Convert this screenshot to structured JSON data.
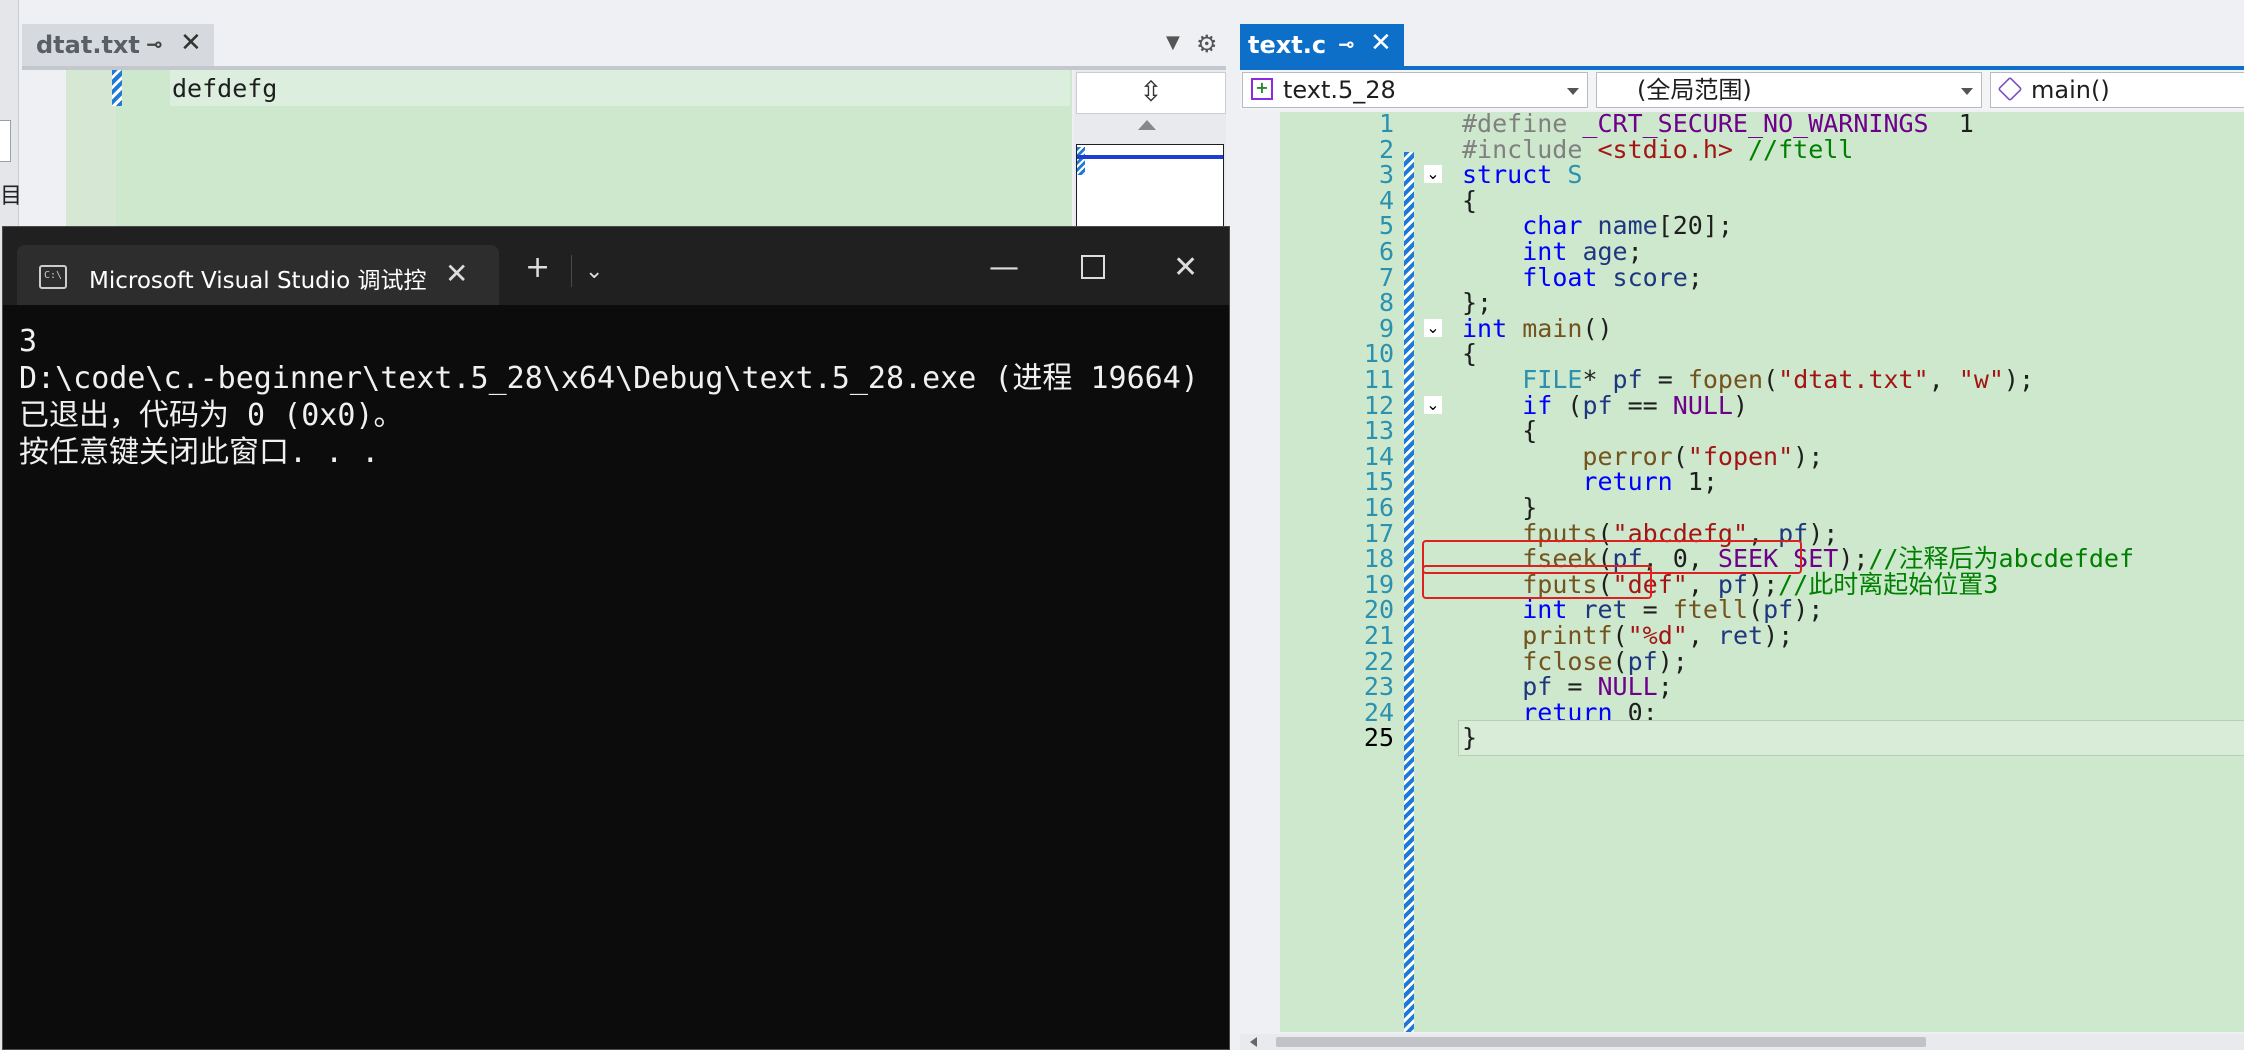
{
  "left_editor": {
    "tab_title": "dtat.txt",
    "content_line": "defdefg",
    "edge_char": "目"
  },
  "right_editor": {
    "tab_title": "text.c",
    "nav": {
      "project": "text.5_28",
      "scope": "(全局范围)",
      "function": "main()"
    },
    "current_line": 25,
    "lines": [
      {
        "n": 1,
        "tokens": [
          [
            "p",
            "#define "
          ],
          [
            "m",
            "_CRT_SECURE_NO_WARNINGS"
          ],
          [
            "",
            "  1"
          ]
        ]
      },
      {
        "n": 2,
        "tokens": [
          [
            "p",
            "#include "
          ],
          [
            "h",
            "<stdio.h>"
          ],
          [
            "c",
            " //ftell"
          ]
        ]
      },
      {
        "n": 3,
        "fold": true,
        "tokens": [
          [
            "k",
            "struct "
          ],
          [
            "t",
            "S"
          ]
        ]
      },
      {
        "n": 4,
        "tokens": [
          [
            "",
            "{"
          ]
        ]
      },
      {
        "n": 5,
        "tokens": [
          [
            "",
            "    "
          ],
          [
            "k",
            "char "
          ],
          [
            "v",
            "name"
          ],
          [
            "",
            "[20];"
          ]
        ]
      },
      {
        "n": 6,
        "tokens": [
          [
            "",
            "    "
          ],
          [
            "k",
            "int "
          ],
          [
            "v",
            "age"
          ],
          [
            "",
            ";"
          ]
        ]
      },
      {
        "n": 7,
        "tokens": [
          [
            "",
            "    "
          ],
          [
            "k",
            "float "
          ],
          [
            "v",
            "score"
          ],
          [
            "",
            ";"
          ]
        ]
      },
      {
        "n": 8,
        "tokens": [
          [
            "",
            "};"
          ]
        ]
      },
      {
        "n": 9,
        "fold": true,
        "tokens": [
          [
            "k",
            "int "
          ],
          [
            "f",
            "main"
          ],
          [
            "",
            "()"
          ]
        ]
      },
      {
        "n": 10,
        "tokens": [
          [
            "",
            "{"
          ]
        ]
      },
      {
        "n": 11,
        "tokens": [
          [
            "",
            "    "
          ],
          [
            "t",
            "FILE"
          ],
          [
            "",
            "* "
          ],
          [
            "v",
            "pf"
          ],
          [
            "",
            " = "
          ],
          [
            "f",
            "fopen"
          ],
          [
            "",
            "("
          ],
          [
            "s",
            "\"dtat.txt\""
          ],
          [
            "",
            ", "
          ],
          [
            "s",
            "\"w\""
          ],
          [
            "",
            ");"
          ]
        ]
      },
      {
        "n": 12,
        "fold": true,
        "tokens": [
          [
            "",
            "    "
          ],
          [
            "k",
            "if "
          ],
          [
            "",
            "("
          ],
          [
            "v",
            "pf"
          ],
          [
            "",
            " == "
          ],
          [
            "m",
            "NULL"
          ],
          [
            "",
            ")"
          ]
        ]
      },
      {
        "n": 13,
        "tokens": [
          [
            "",
            "    {"
          ]
        ]
      },
      {
        "n": 14,
        "tokens": [
          [
            "",
            "        "
          ],
          [
            "f",
            "perror"
          ],
          [
            "",
            "("
          ],
          [
            "s",
            "\"fopen\""
          ],
          [
            "",
            ");"
          ]
        ]
      },
      {
        "n": 15,
        "tokens": [
          [
            "",
            "        "
          ],
          [
            "k",
            "return "
          ],
          [
            "",
            "1;"
          ]
        ]
      },
      {
        "n": 16,
        "tokens": [
          [
            "",
            "    }"
          ]
        ]
      },
      {
        "n": 17,
        "tokens": [
          [
            "",
            "    "
          ],
          [
            "f",
            "fputs"
          ],
          [
            "",
            "("
          ],
          [
            "s",
            "\"abcdefg\""
          ],
          [
            "",
            ", "
          ],
          [
            "v",
            "pf"
          ],
          [
            "",
            ");"
          ]
        ]
      },
      {
        "n": 18,
        "tokens": [
          [
            "",
            "    "
          ],
          [
            "f",
            "fseek"
          ],
          [
            "",
            "("
          ],
          [
            "v",
            "pf"
          ],
          [
            "",
            ", 0, "
          ],
          [
            "m",
            "SEEK_SET"
          ],
          [
            "",
            ");"
          ],
          [
            "c",
            "//注释后为abcdefdef"
          ]
        ]
      },
      {
        "n": 19,
        "tokens": [
          [
            "",
            "    "
          ],
          [
            "f",
            "fputs"
          ],
          [
            "",
            "("
          ],
          [
            "s",
            "\"def\""
          ],
          [
            "",
            ", "
          ],
          [
            "v",
            "pf"
          ],
          [
            "",
            ");"
          ],
          [
            "c",
            "//此时离起始位置3"
          ]
        ]
      },
      {
        "n": 20,
        "tokens": [
          [
            "",
            "    "
          ],
          [
            "k",
            "int "
          ],
          [
            "v",
            "ret"
          ],
          [
            "",
            " = "
          ],
          [
            "f",
            "ftell"
          ],
          [
            "",
            "("
          ],
          [
            "v",
            "pf"
          ],
          [
            "",
            ");"
          ]
        ]
      },
      {
        "n": 21,
        "tokens": [
          [
            "",
            "    "
          ],
          [
            "f",
            "printf"
          ],
          [
            "",
            "("
          ],
          [
            "s",
            "\"%d\""
          ],
          [
            "",
            ", "
          ],
          [
            "v",
            "ret"
          ],
          [
            "",
            ");"
          ]
        ]
      },
      {
        "n": 22,
        "tokens": [
          [
            "",
            "    "
          ],
          [
            "f",
            "fclose"
          ],
          [
            "",
            "("
          ],
          [
            "v",
            "pf"
          ],
          [
            "",
            ");"
          ]
        ]
      },
      {
        "n": 23,
        "tokens": [
          [
            "",
            "    "
          ],
          [
            "v",
            "pf"
          ],
          [
            "",
            " = "
          ],
          [
            "m",
            "NULL"
          ],
          [
            "",
            ";"
          ]
        ]
      },
      {
        "n": 24,
        "tokens": [
          [
            "",
            "    "
          ],
          [
            "k",
            "return "
          ],
          [
            "",
            "0;"
          ]
        ]
      },
      {
        "n": 25,
        "tokens": [
          [
            "",
            "}"
          ]
        ]
      }
    ]
  },
  "console": {
    "tab_title": "Microsoft Visual Studio 调试控",
    "output": "3\nD:\\code\\c.-beginner\\text.5_28\\x64\\Debug\\text.5_28.exe (进程 19664)已退出，代码为 0 (0x0)。\n按任意键关闭此窗口. . ."
  },
  "colors": {
    "editor_background": "#cde8cc",
    "active_tab": "#0e6fc8",
    "console_background": "#0c0c0c",
    "highlight_box": "#e02020"
  },
  "icons": [
    "pin-icon",
    "close-icon",
    "dropdown-icon",
    "gear-icon",
    "split-icon",
    "terminal-icon",
    "plus-icon",
    "chevron-down-icon",
    "minimize-icon",
    "maximize-icon",
    "project-icon",
    "function-icon"
  ]
}
